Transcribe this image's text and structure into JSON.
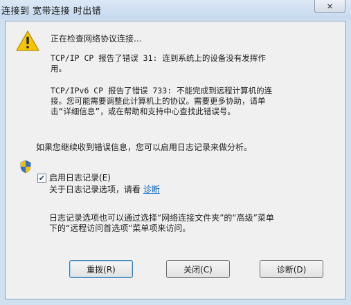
{
  "window": {
    "title": "连接到 宽带连接 时出错",
    "close_glyph": "✕"
  },
  "messages": {
    "checking": "正在检查网络协议连接...",
    "tcpip_line1": "TCP/IP CP 报告了错误 31: 连到系统上的设备没有发挥作",
    "tcpip_line2": "用。",
    "ipv6_line1": "TCP/IPv6 CP 报告了错误 733: 不能完成到远程计算机的连",
    "ipv6_line2": "接。您可能需要调整此计算机上的协议。需要更多协助，请单",
    "ipv6_line3": "击“详细信息”，或在帮助和支持中心查找此错误号。",
    "repeat_hint": "如果您继续收到错误信息，您可以启用日志记录来做分析。"
  },
  "logging": {
    "checkbox_label": "启用日志记录(E)",
    "checked": true,
    "options_prefix": "关于日志记录选项，请看",
    "options_link": "诊断",
    "note_line1": "日志记录选项也可以通过选择“网络连接文件夹”的“高级”菜单",
    "note_line2": "下的“远程访问首选项”菜单项来访问。"
  },
  "buttons": {
    "redial": "重拨(R)",
    "close": "关闭(C)",
    "diagnose": "诊断(D)"
  },
  "icons": {
    "warning": "warning-icon",
    "shield": "uac-shield-icon",
    "close": "close-icon"
  }
}
